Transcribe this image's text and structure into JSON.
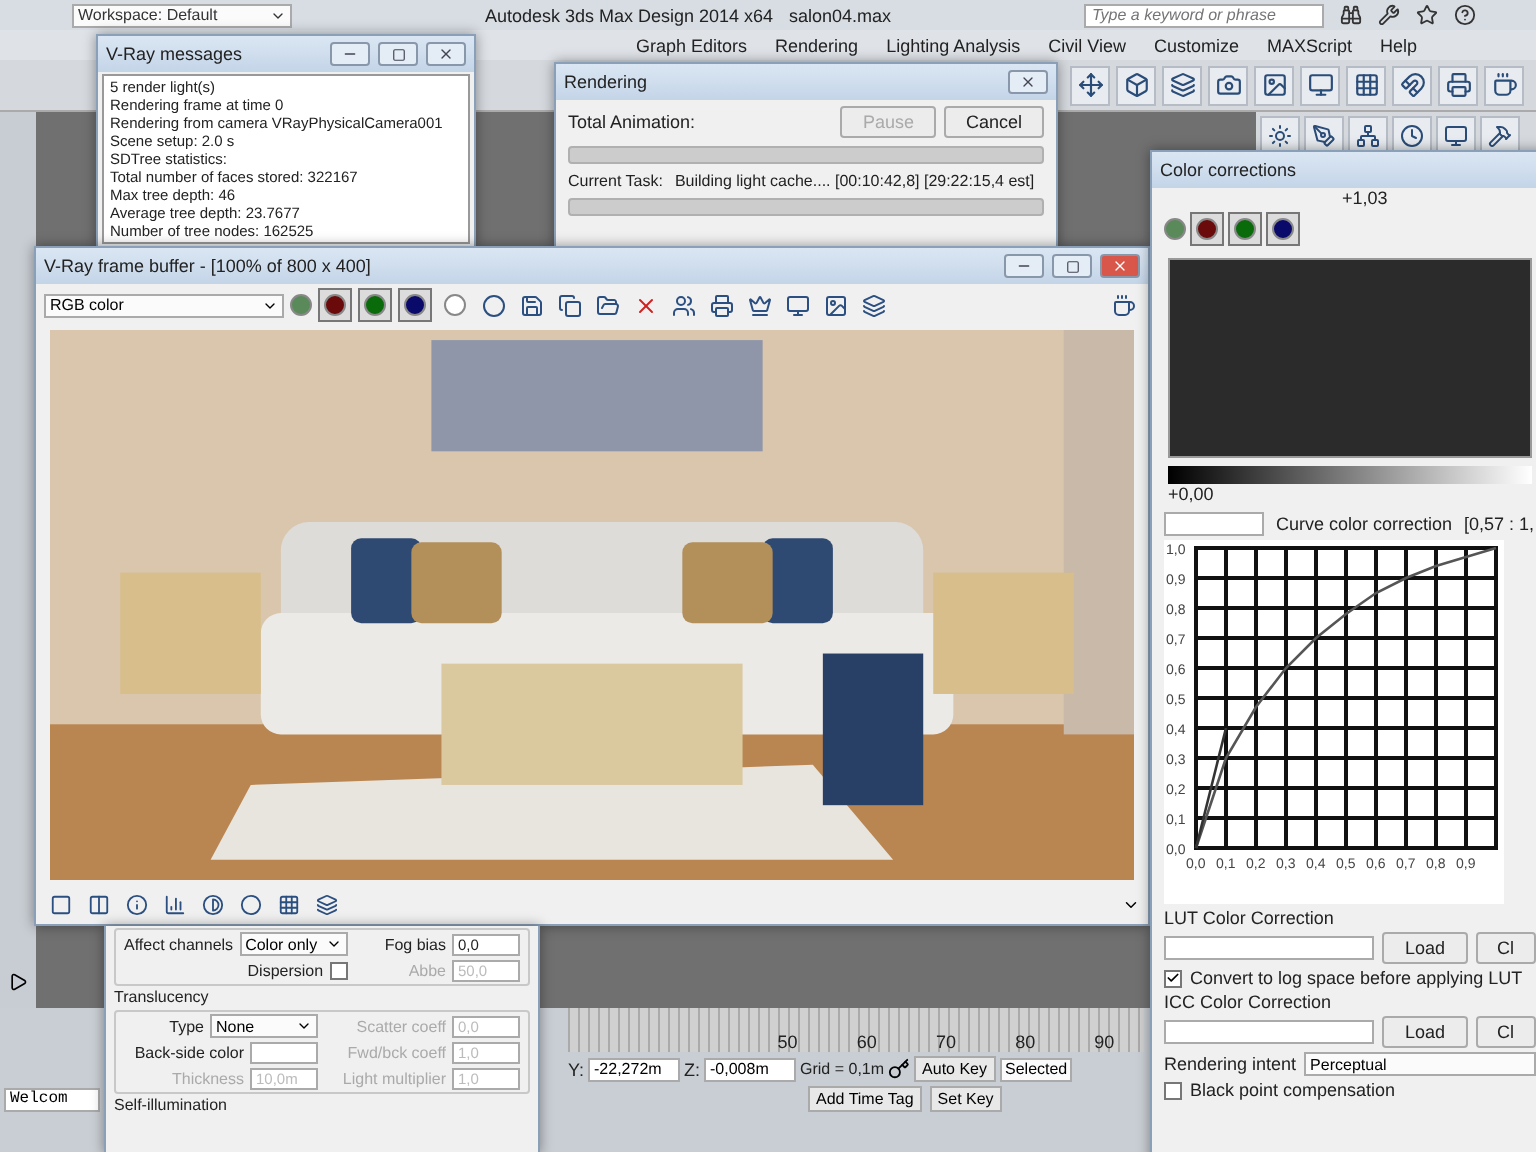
{
  "app": {
    "title": "Autodesk 3ds Max Design 2014 x64",
    "file": "salon04.max",
    "workspace": "Workspace: Default",
    "search": {
      "placeholder": "Type a keyword or phrase"
    },
    "menu": [
      "Graph Editors",
      "Rendering",
      "Lighting Analysis",
      "Civil View",
      "Customize",
      "MAXScript",
      "Help"
    ]
  },
  "messages_window": {
    "title": "V-Ray messages",
    "lines": [
      "5 render light(s)",
      "Rendering frame at time 0",
      "Rendering from camera VRayPhysicalCamera001",
      "Scene setup: 2.0 s",
      "SDTree statistics:",
      "Total number of faces stored: 322167",
      "Max tree depth: 46",
      "Average tree depth: 23.7677",
      "Number of tree nodes: 162525"
    ]
  },
  "rendering_window": {
    "title": "Rendering",
    "total_label": "Total Animation:",
    "pause": {
      "label": "Pause",
      "disabled": true
    },
    "cancel": {
      "label": "Cancel",
      "disabled": false
    },
    "total_progress": {
      "level": 0
    },
    "task_label": "Current Task:",
    "task": "Building light cache.... [00:10:42,8] [29:22:15,4 est]",
    "task_progress": {
      "level": 0
    }
  },
  "frame_buffer": {
    "title": "V-Ray frame buffer - [100% of 800 x 400]",
    "channel_select": "RGB color",
    "channels": [
      {
        "color": "#6b0a0a",
        "selected": true
      },
      {
        "color": "#0a6b0a",
        "selected": true
      },
      {
        "color": "#0a0a6b",
        "selected": true
      },
      {
        "color": "#ffffff",
        "selected": false
      }
    ]
  },
  "color_corrections": {
    "title": "Color corrections",
    "white_point": "+1,03",
    "channels": [
      {
        "color": "#6b0a0a",
        "selected": true
      },
      {
        "color": "#0a6b0a",
        "selected": true
      },
      {
        "color": "#0a0a6b",
        "selected": true
      }
    ],
    "black_point": "+0,00",
    "curve": {
      "title": "Curve color correction",
      "readout": "[0,57 : 1,",
      "chart_data": {
        "type": "line",
        "grid": true,
        "x": [
          0,
          0.1,
          0.2,
          0.3,
          0.4,
          0.5,
          0.6,
          0.7,
          0.8,
          0.9,
          1.0
        ],
        "series": [
          {
            "color": "#555555",
            "values": [
              0,
              0.3,
              0.47,
              0.6,
              0.7,
              0.78,
              0.85,
              0.9,
              0.94,
              0.97,
              1.0
            ]
          },
          {
            "color": "#333333",
            "values": [
              0,
              0.4,
              null,
              null,
              null,
              null,
              null,
              null,
              null,
              null,
              null
            ]
          }
        ],
        "xlim": [
          0,
          1
        ],
        "ylim": [
          0,
          1
        ],
        "xticks": [
          {
            "value": 0,
            "label": "0,0"
          },
          {
            "value": 0.1,
            "label": "0,1"
          },
          {
            "value": 0.2,
            "label": "0,2"
          },
          {
            "value": 0.3,
            "label": "0,3"
          },
          {
            "value": 0.4,
            "label": "0,4"
          },
          {
            "value": 0.5,
            "label": "0,5"
          },
          {
            "value": 0.6,
            "label": "0,6"
          },
          {
            "value": 0.7,
            "label": "0,7"
          },
          {
            "value": 0.8,
            "label": "0,8"
          },
          {
            "value": 0.9,
            "label": "0,9"
          }
        ],
        "yticks": [
          {
            "value": 0,
            "label": "0,0"
          },
          {
            "value": 0.1,
            "label": "0,1"
          },
          {
            "value": 0.2,
            "label": "0,2"
          },
          {
            "value": 0.3,
            "label": "0,3"
          },
          {
            "value": 0.4,
            "label": "0,4"
          },
          {
            "value": 0.5,
            "label": "0,5"
          },
          {
            "value": 0.6,
            "label": "0,6"
          },
          {
            "value": 0.7,
            "label": "0,7"
          },
          {
            "value": 0.8,
            "label": "0,8"
          },
          {
            "value": 0.9,
            "label": "0,9"
          },
          {
            "value": 1,
            "label": "1,0"
          }
        ]
      }
    },
    "lut": {
      "label": "LUT Color Correction",
      "load": "Load",
      "clear": "Cl",
      "convert": {
        "label": "Convert to log space before applying LUT",
        "checked": true
      }
    },
    "icc": {
      "label": "ICC Color Correction",
      "load": "Load",
      "clear": "Cl",
      "intent_label": "Rendering intent",
      "intent": "Perceptual",
      "black_point": {
        "label": "Black point compensation",
        "checked": false
      }
    }
  },
  "material_panel": {
    "sections": [
      {
        "fields": [
          {
            "kind": "dropdown",
            "label": "Affect channels",
            "value": "Color only",
            "disabled": false
          },
          {
            "kind": "spinner",
            "label": "Fog bias",
            "value": "0,0",
            "disabled": false
          },
          {
            "kind": "checkbox",
            "label": "Dispersion",
            "checked": false,
            "disabled": false
          },
          {
            "kind": "spinner",
            "label": "Abbe",
            "value": "50,0",
            "disabled": true
          }
        ]
      },
      {
        "title": "Translucency",
        "fields": [
          {
            "kind": "dropdown",
            "label": "Type",
            "value": "None",
            "disabled": false
          },
          {
            "kind": "spinner",
            "label": "Scatter coeff",
            "value": "0,0",
            "disabled": true
          },
          {
            "kind": "color",
            "label": "Back-side color",
            "disabled": false
          },
          {
            "kind": "spinner",
            "label": "Fwd/bck coeff",
            "value": "1,0",
            "disabled": true
          },
          {
            "kind": "spinner",
            "label": "Thickness",
            "value": "10,0m",
            "disabled": true
          },
          {
            "kind": "spinner",
            "label": "Light multiplier",
            "value": "1,0",
            "disabled": true
          }
        ]
      },
      {
        "title": "Self-illumination"
      }
    ]
  },
  "status": {
    "welcome": "Welcom",
    "ticks": [
      "50",
      "60",
      "70",
      "80",
      "90"
    ],
    "coords": [
      {
        "label": "Y:",
        "value": "-22,272m"
      },
      {
        "label": "Z:",
        "value": "-0,008m"
      }
    ],
    "grid": "Grid = 0,1m",
    "add_time_tag": "Add Time Tag",
    "auto_key": "Auto Key",
    "key_filter": "Selected",
    "set_key": "Set Key"
  }
}
